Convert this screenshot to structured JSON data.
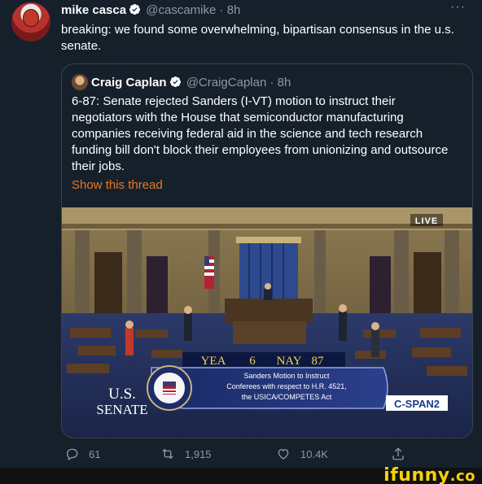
{
  "tweet": {
    "name": "mike casca",
    "handle": "@cascamike",
    "separator": "·",
    "time": "8h",
    "more": "···",
    "text": "breaking: we found some overwhelming, bipartisan consensus in the u.s. senate."
  },
  "quoted": {
    "name": "Craig Caplan",
    "handle": "@CraigCaplan",
    "separator": "·",
    "time": "8h",
    "text": "6-87: Senate rejected Sanders (I-VT) motion to instruct their negotiators with the House that semiconductor manufacturing companies receiving federal aid in the science and tech research funding bill don't block their employees from unionizing and outsource their jobs.",
    "show_thread": "Show this thread"
  },
  "media": {
    "live_label": "LIVE",
    "vote_yea_label": "YEA",
    "vote_yea": "6",
    "vote_nay_label": "NAY",
    "vote_nay": "87",
    "motion_line1": "Sanders Motion to Instruct",
    "motion_line2": "Conferees with respect to H.R. 4521,",
    "motion_line3": "the USICA/COMPETES Act",
    "chamber_line1": "U.S.",
    "chamber_line2": "SENATE",
    "network": "C-SPAN2"
  },
  "actions": {
    "replies": "61",
    "retweets": "1,915",
    "likes": "10.4K"
  },
  "watermark": {
    "text": "ifunny",
    "suffix": ".co"
  },
  "colors": {
    "background": "#15202b",
    "muted": "#8b98a5",
    "link": "#e8782a",
    "verified": "#1d9bf0",
    "watermark": "#f5d20a"
  }
}
